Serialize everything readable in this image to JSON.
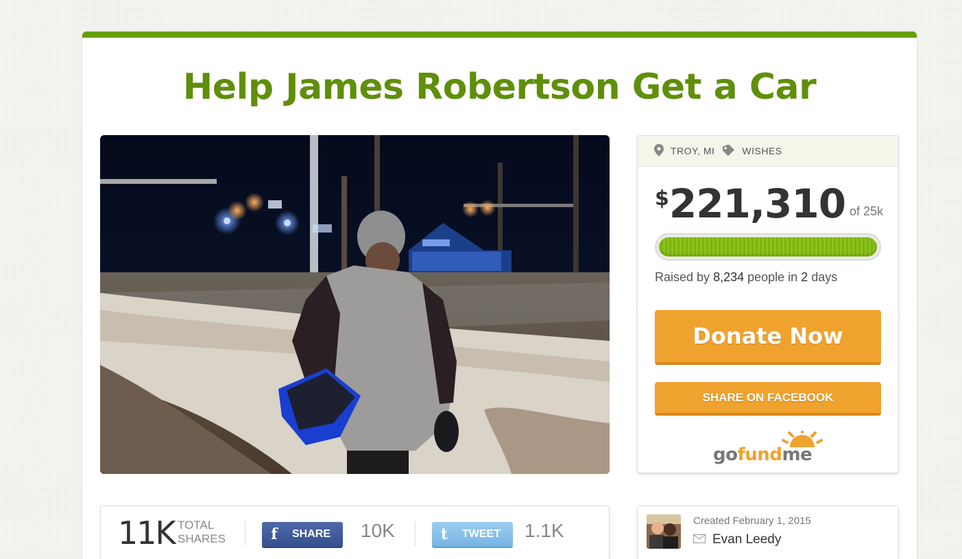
{
  "campaign": {
    "title": "Help James Robertson Get a Car"
  },
  "meta": {
    "location": "TROY, MI",
    "category": "WISHES"
  },
  "funding": {
    "currency": "$",
    "amount": "221,310",
    "goal_text": "of 25k",
    "progress": 1.0,
    "raised_prefix": "Raised by",
    "people": "8,234",
    "people_label": "people in",
    "days": "2",
    "days_label": "days"
  },
  "buttons": {
    "donate": "Donate Now",
    "share_facebook": "SHARE ON FACEBOOK"
  },
  "logo": {
    "part1": "go",
    "part2": "fund",
    "part3": "me"
  },
  "shares": {
    "total": "11K",
    "total_label": "TOTAL SHARES",
    "facebook_label": "SHARE",
    "facebook_count": "10K",
    "twitter_label": "TWEET",
    "twitter_count": "1.1K"
  },
  "creator": {
    "created": "Created February 1, 2015",
    "name": "Evan Leedy"
  },
  "colors": {
    "brand_green": "#66a000",
    "title_green": "#5f8f0a",
    "orange": "#f0a22e",
    "facebook": "#3b5998",
    "twitter": "#7fbce8"
  },
  "icons": {
    "location": "map-pin-icon",
    "category": "tag-icon",
    "facebook": "facebook-icon",
    "twitter": "twitter-icon",
    "mail": "envelope-icon"
  }
}
